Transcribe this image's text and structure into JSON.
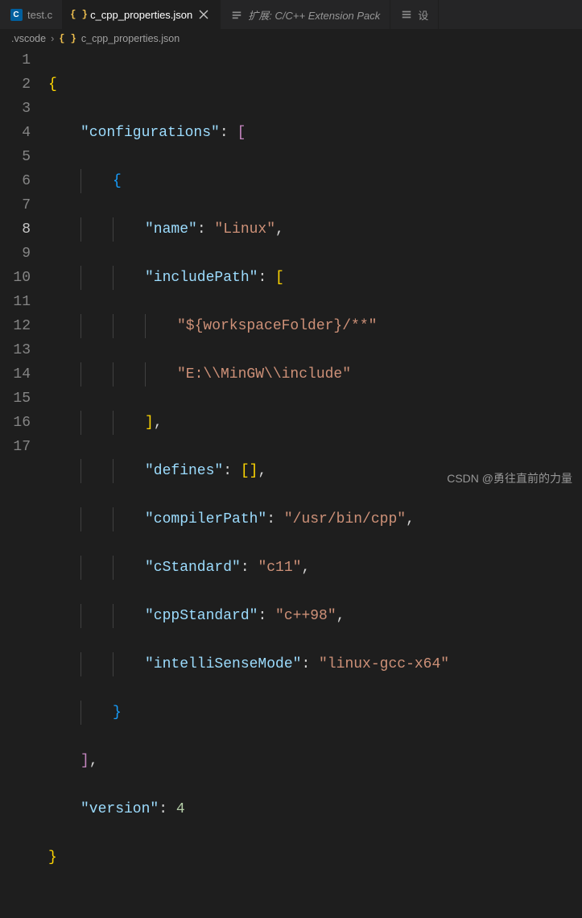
{
  "tabs": [
    {
      "label": "test.c",
      "icon": "c-file-icon",
      "active": false
    },
    {
      "label": "c_cpp_properties.json",
      "icon": "json-file-icon",
      "active": true
    },
    {
      "label": "扩展: C/C++ Extension Pack",
      "icon": "extension-icon",
      "active": false,
      "italic": true
    },
    {
      "label": "设",
      "icon": "settings-icon",
      "active": false
    }
  ],
  "breadcrumbs": {
    "folder": ".vscode",
    "file": "c_cpp_properties.json",
    "file_icon": "json-file-icon",
    "separator": "›"
  },
  "active_line": 8,
  "code_content": {
    "configurations_key": "\"configurations\"",
    "name_key": "\"name\"",
    "name_val": "\"Linux\"",
    "includePath_key": "\"includePath\"",
    "include_val1": "\"${workspaceFolder}/**\"",
    "include_val2": "\"E:\\\\MinGW\\\\include\"",
    "defines_key": "\"defines\"",
    "compilerPath_key": "\"compilerPath\"",
    "compilerPath_val": "\"/usr/bin/cpp\"",
    "cStandard_key": "\"cStandard\"",
    "cStandard_val": "\"c11\"",
    "cppStandard_key": "\"cppStandard\"",
    "cppStandard_val": "\"c++98\"",
    "intelliSenseMode_key": "\"intelliSenseMode\"",
    "intelliSenseMode_val": "\"linux-gcc-x64\"",
    "version_key": "\"version\"",
    "version_val": "4"
  },
  "line_numbers": [
    "1",
    "2",
    "3",
    "4",
    "5",
    "6",
    "7",
    "8",
    "9",
    "10",
    "11",
    "12",
    "13",
    "14",
    "15",
    "16",
    "17"
  ],
  "watermark": "CSDN @勇往直前的力量"
}
